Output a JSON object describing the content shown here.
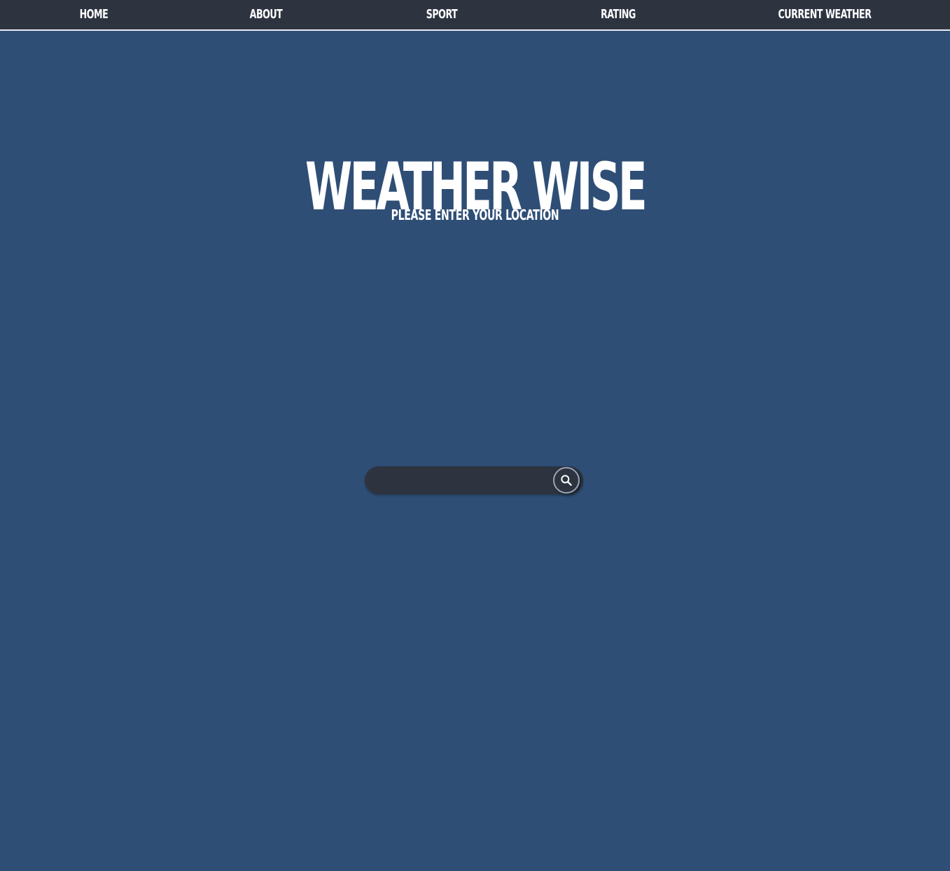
{
  "nav": {
    "items": [
      {
        "label": "HOME"
      },
      {
        "label": "ABOUT"
      },
      {
        "label": "SPORT"
      },
      {
        "label": "RATING"
      },
      {
        "label": "CURRENT WEATHER"
      }
    ]
  },
  "hero": {
    "title": "WEATHER WISE",
    "subtitle": "PLEASE ENTER YOUR LOCATION"
  },
  "search": {
    "value": "",
    "placeholder": "",
    "button_icon": "search-icon"
  },
  "colors": {
    "page_background": "#2f4e76",
    "navbar_background": "#2d3440",
    "text": "#ffffff",
    "search_background": "#2d3440"
  }
}
